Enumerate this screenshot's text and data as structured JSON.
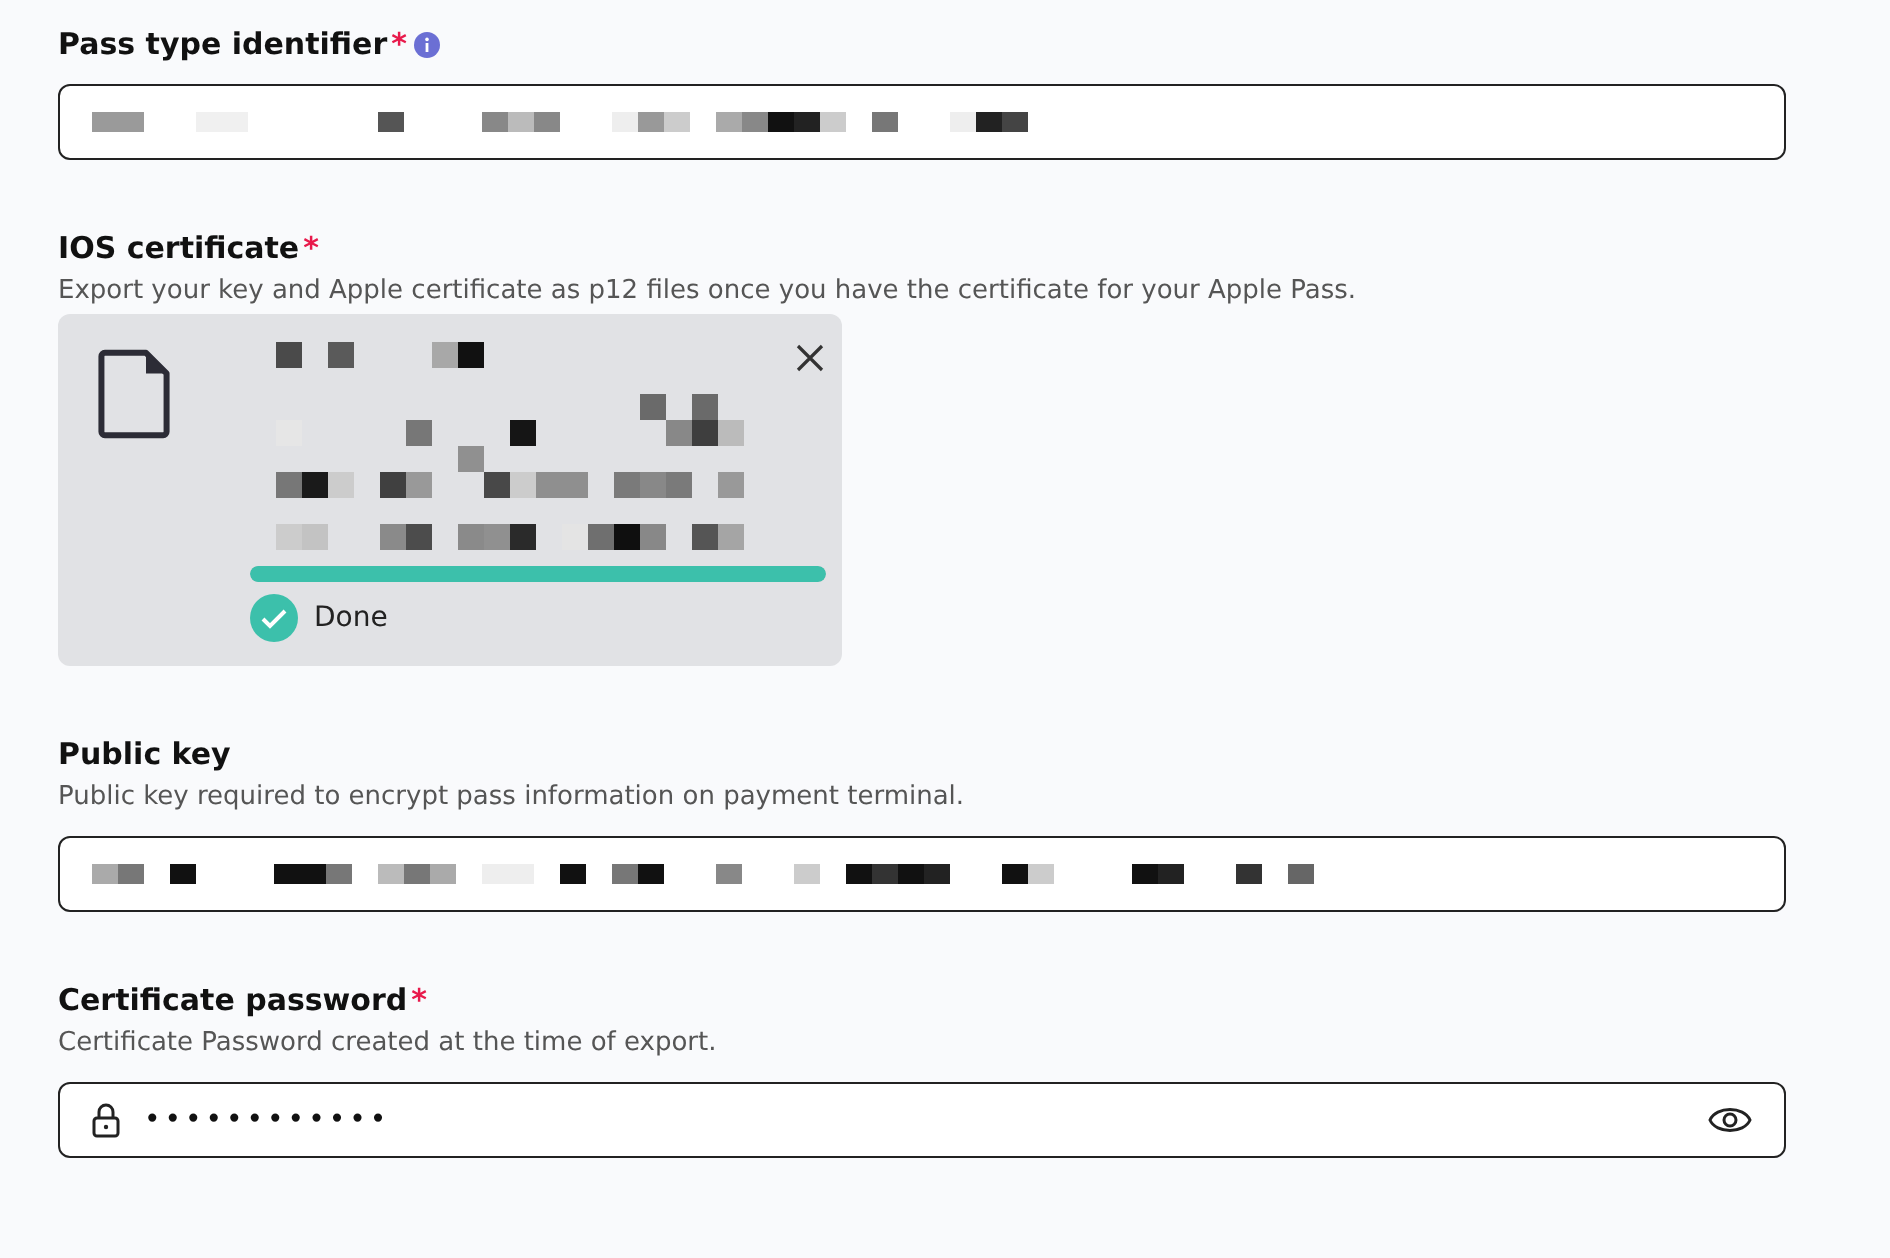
{
  "fields": [
    {
      "kind": "text-input",
      "label": "Pass type identifier",
      "required_mark": "*",
      "info": true
    },
    {
      "kind": "upload",
      "label": "IOS certificate",
      "required_mark": "*",
      "description": "Export your key and Apple certificate as p12 files once you have the certificate for your Apple Pass.",
      "file": {
        "level": 1,
        "status": "Done",
        "done": true
      }
    },
    {
      "kind": "text-input",
      "label": "Public key",
      "description": "Public key required to encrypt pass information on payment terminal."
    },
    {
      "kind": "password",
      "label": "Certificate password",
      "required_mark": "*",
      "description": "Certificate Password created at the time of export.",
      "value": "••••••••••••"
    }
  ]
}
